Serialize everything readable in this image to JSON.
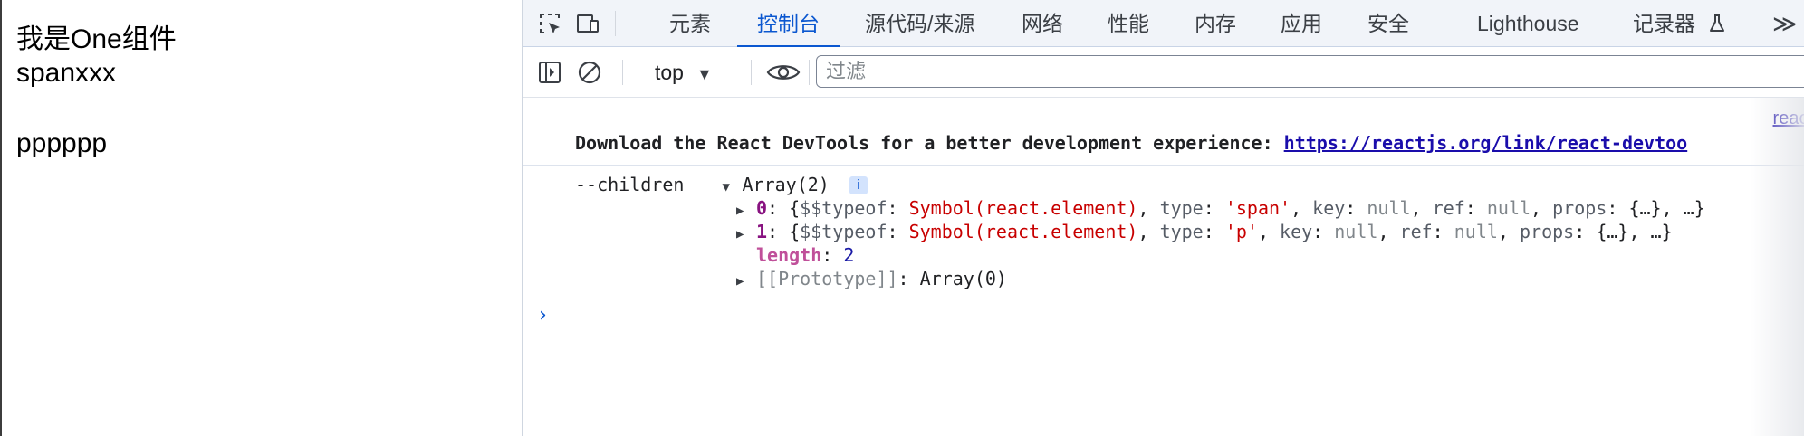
{
  "page": {
    "line1": "我是One组件",
    "line2": "spanxxx",
    "line3": "pppppp"
  },
  "devtools": {
    "tabs": [
      "元素",
      "控制台",
      "源代码/来源",
      "网络",
      "性能",
      "内存",
      "应用",
      "安全",
      "Lighthouse",
      "记录器"
    ],
    "active_tab": "控制台",
    "recorder_icon": "flask-icon",
    "more_label": "≫",
    "toolbar": {
      "context": "top",
      "filter_placeholder": "过滤"
    },
    "console": {
      "source_link": "react",
      "download_text": "Download the React DevTools for a better development experience: ",
      "download_link": "https://reactjs.org/link/react-devtoo",
      "log_label": "--children",
      "array_summary": "Array(2)",
      "info_badge": "i",
      "items": [
        {
          "index": "0",
          "typeof_key": "$$typeof",
          "typeof_val": "Symbol(react.element)",
          "type_key": "type",
          "type_val": "'span'",
          "key_key": "key",
          "key_val": "null",
          "ref_key": "ref",
          "ref_val": "null",
          "props_key": "props",
          "props_val": "{…}",
          "tail": ", …}"
        },
        {
          "index": "1",
          "typeof_key": "$$typeof",
          "typeof_val": "Symbol(react.element)",
          "type_key": "type",
          "type_val": "'p'",
          "key_key": "key",
          "key_val": "null",
          "ref_key": "ref",
          "ref_val": "null",
          "props_key": "props",
          "props_val": "{…}",
          "tail": ", …}"
        }
      ],
      "length_key": "length",
      "length_val": "2",
      "proto_key": "[[Prototype]]",
      "proto_val": "Array(0)",
      "prompt": "›"
    },
    "colors": {
      "accent": "#0b57d0",
      "string": "#c80000",
      "index": "#881280"
    }
  }
}
